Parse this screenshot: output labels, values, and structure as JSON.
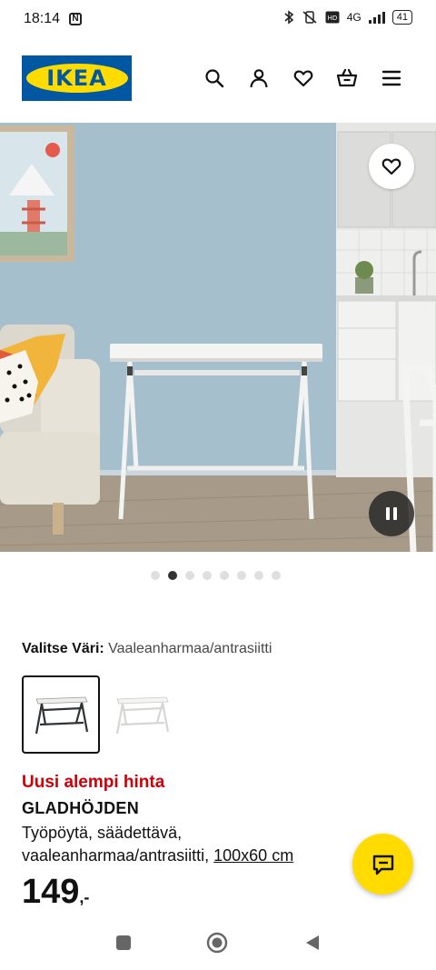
{
  "status_bar": {
    "time": "18:14",
    "network": "4G",
    "battery": "41"
  },
  "header": {
    "logo_text": "IKEA",
    "icons": [
      "search-icon",
      "account-icon",
      "heart-icon",
      "basket-icon",
      "menu-icon"
    ]
  },
  "gallery": {
    "dot_count": 8,
    "active_index": 1
  },
  "product": {
    "color_label": "Valitse Väri:",
    "color_value": "Vaaleanharmaa/antrasiitti",
    "price_label": "Uusi alempi hinta",
    "name": "GLADHÖJDEN",
    "description": "Työpöytä, säädettävä, vaaleanharmaa/antrasiitti,",
    "size": "100x60 cm",
    "price": "149",
    "price_suffix": ",-"
  },
  "colors": {
    "ikea_blue": "#0058a3",
    "ikea_yellow": "#ffdb00",
    "price_red": "#cc0008"
  }
}
